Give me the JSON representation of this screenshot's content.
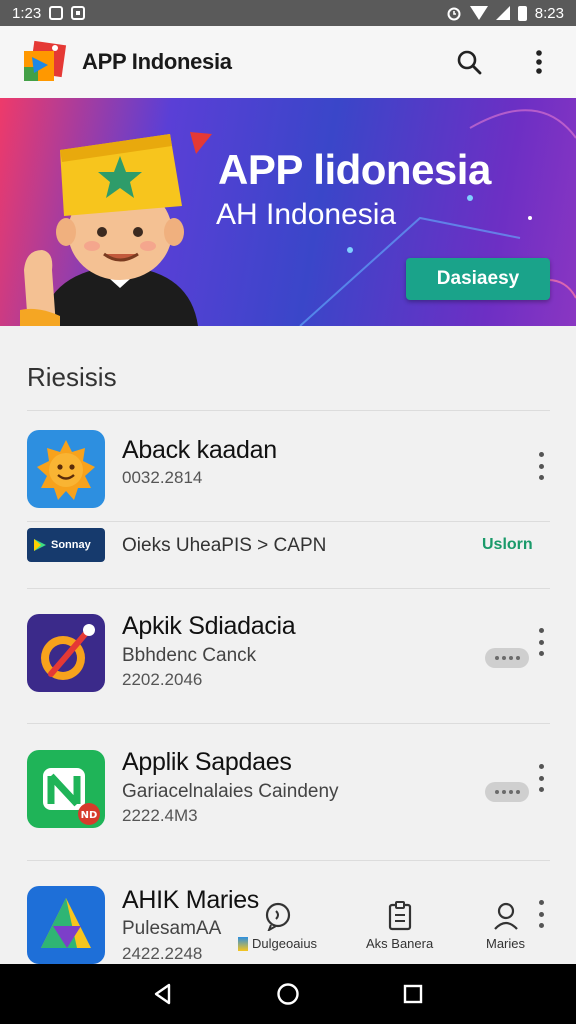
{
  "status_bar": {
    "time_left": "1:23",
    "time_right": "8:23"
  },
  "app_bar": {
    "title": "APP Indonesia",
    "icons": [
      "app-logo",
      "search-icon",
      "more-vert-icon"
    ]
  },
  "banner": {
    "title": "AP​​P lidonesia",
    "subtitle": "AH Indonesia",
    "button_label": "Dasiaesy",
    "colors": {
      "start": "#ee3a6a",
      "mid": "#3a46c9",
      "end": "#8a36c2",
      "button": "#1aa38a"
    }
  },
  "section": {
    "title": "Riesisis"
  },
  "apps": [
    {
      "title": "Aback kaadan",
      "subtitle": "",
      "date": "0032.2814",
      "icon": "sun-face-icon",
      "icon_bg": "#2d8fe0"
    },
    {
      "title": "Apkik Sdiadacia",
      "subtitle": "Bbhdenc Canck",
      "date": "2202.2046",
      "icon": "compass-rocket-icon",
      "icon_bg": "#3b2a8a"
    },
    {
      "title": "Applik Sapdaes",
      "subtitle": "Gariacelnalaies Caindeny",
      "date": "2222.4M3",
      "icon": "n-logo-icon",
      "icon_bg": "#1fb458"
    },
    {
      "title": "AHIK Maries",
      "subtitle": "PulesamAA",
      "date": "2422.2248",
      "icon": "triangle-logo-icon",
      "icon_bg": "#1e6fd8"
    }
  ],
  "sponsored": {
    "badge_label": "Sonnay",
    "text": "Oieks UheaPIS > CAPN",
    "store_label": "Uslorn"
  },
  "bottom_tabs": [
    {
      "label": "Dulgeoaius",
      "icon": "chat-bubble-icon"
    },
    {
      "label": "Aks Banera",
      "icon": "clipboard-icon"
    },
    {
      "label": "Maries",
      "icon": "person-icon"
    }
  ],
  "nav_bar": {
    "icons": [
      "back-icon",
      "home-icon",
      "recents-icon"
    ]
  }
}
